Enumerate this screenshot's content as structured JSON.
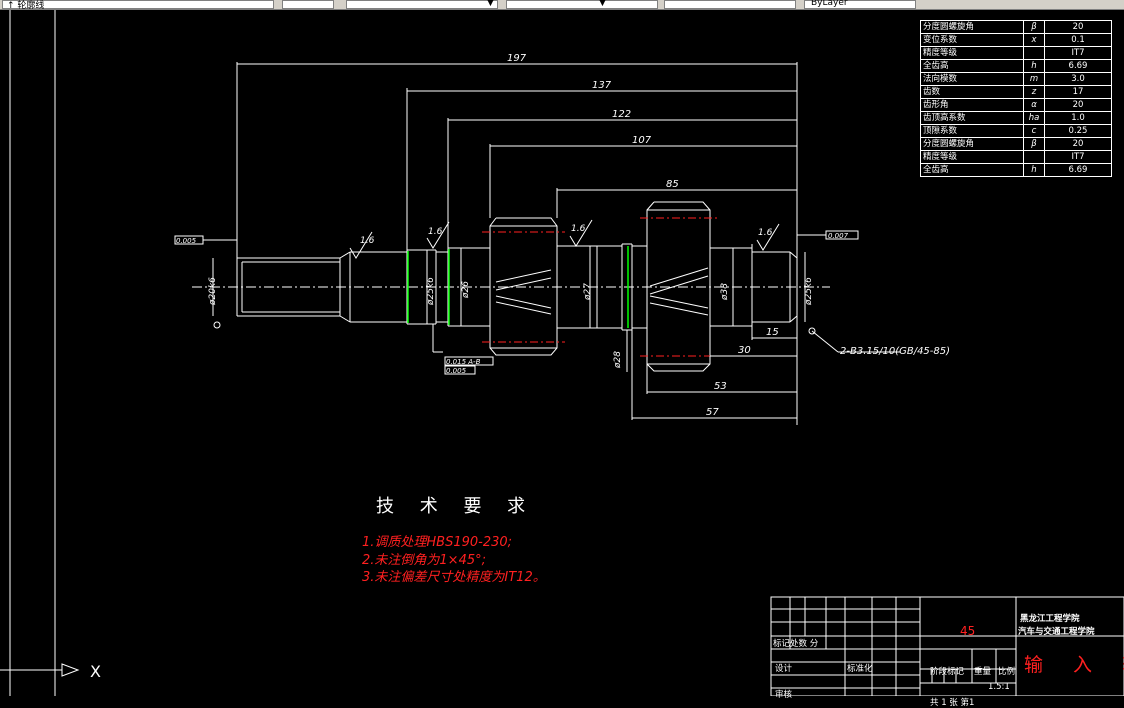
{
  "toolbar": {
    "layer_label": "↑ 轮廓线",
    "field2_label": "▼",
    "field3_label": "▼",
    "field4_label": "ByLayer"
  },
  "dimensions": {
    "d197": "197",
    "d137": "137",
    "d122": "122",
    "d107": "107",
    "d85": "85",
    "d15": "15",
    "d30": "30",
    "d53": "53",
    "d57": "57",
    "phi25a": "ø25k6",
    "phi26": "ø26",
    "phi27": "ø27",
    "phi28": "ø28",
    "phi38": "ø38",
    "phi25b": "ø25k6",
    "phi20": "ø20k6",
    "rough": "1.6",
    "tol_left": "0.005",
    "tol_right": "0.007",
    "tol_box1": "0.015 A-B",
    "tol_box2": "0.005",
    "center_hole": "2-B3.15/10(GB/45-85)"
  },
  "requirements": {
    "title": "技 术 要 求",
    "items": [
      "1.调质处理HBS190-230;",
      "2.未注倒角为1×45°;",
      "3.未注偏差尺寸处精度为IT12。"
    ]
  },
  "gear_table": {
    "rows": [
      {
        "name": "分度圆螺旋角",
        "sym": "β",
        "val": "20"
      },
      {
        "name": "变位系数",
        "sym": "x",
        "val": "0.1"
      },
      {
        "name": "精度等级",
        "sym": "",
        "val": "IT7"
      },
      {
        "name": "全齿高",
        "sym": "h",
        "val": "6.69"
      },
      {
        "name": "法向模数",
        "sym": "m",
        "val": "3.0"
      },
      {
        "name": "齿数",
        "sym": "z",
        "val": "17"
      },
      {
        "name": "齿形角",
        "sym": "α",
        "val": "20"
      },
      {
        "name": "齿顶高系数",
        "sym": "ha",
        "val": "1.0"
      },
      {
        "name": "顶隙系数",
        "sym": "c",
        "val": "0.25"
      },
      {
        "name": "分度圆螺旋角",
        "sym": "β",
        "val": "20"
      },
      {
        "name": "精度等级",
        "sym": "",
        "val": "IT7"
      },
      {
        "name": "全齿高",
        "sym": "h",
        "val": "6.69"
      }
    ]
  },
  "title_block": {
    "material": "45",
    "school_line1": "黑龙江工程学院",
    "school_line2": "汽车与交通工程学院",
    "part_name": "输 入 轴",
    "mark_label": "标记处数 分",
    "design": "设计",
    "standard": "标准化",
    "review": "审核",
    "stage_mark": "阶段标记",
    "weight": "重量",
    "scale": "比例",
    "scale_val": "1.5:1",
    "sheets": "共 1 张 第1"
  },
  "ucs": {
    "x_label": "X"
  }
}
